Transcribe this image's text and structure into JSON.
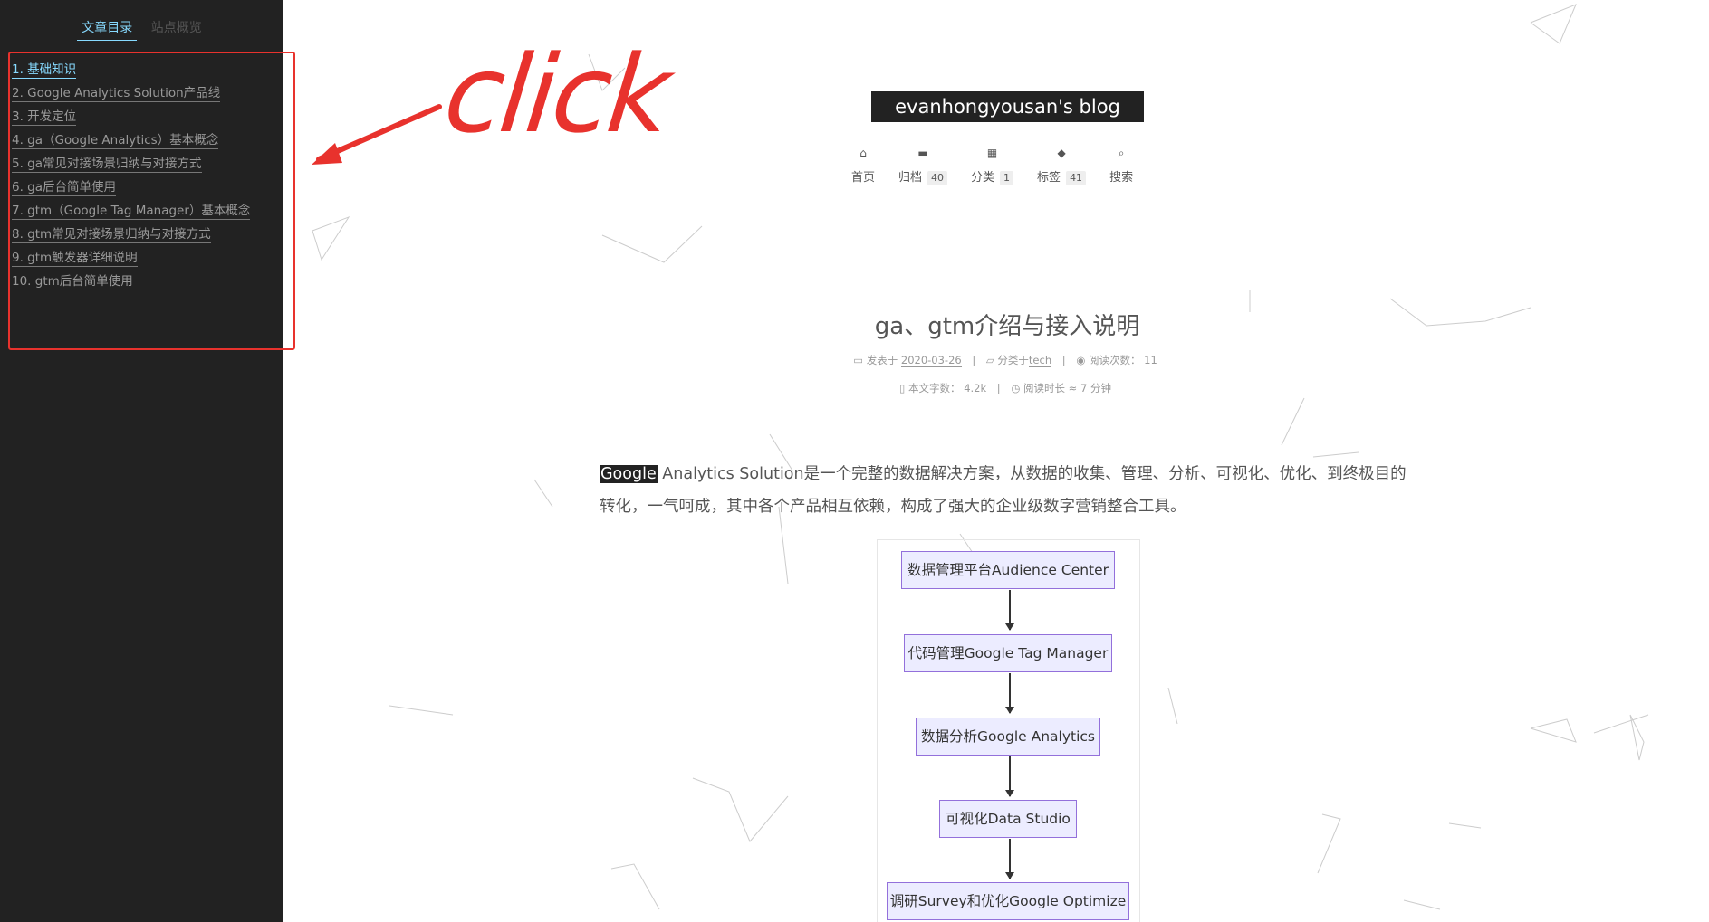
{
  "sidebar": {
    "tabs": [
      {
        "label": "文章目录",
        "active": true
      },
      {
        "label": "站点概览",
        "active": false
      }
    ],
    "toc": [
      {
        "label": "1. 基础知识",
        "active": true
      },
      {
        "label": "2. Google Analytics Solution产品线",
        "active": false
      },
      {
        "label": "3. 开发定位",
        "active": false
      },
      {
        "label": "4. ga（Google Analytics）基本概念",
        "active": false
      },
      {
        "label": "5. ga常见对接场景归纳与对接方式",
        "active": false
      },
      {
        "label": "6. ga后台简单使用",
        "active": false
      },
      {
        "label": "7. gtm（Google Tag Manager）基本概念",
        "active": false
      },
      {
        "label": "8. gtm常见对接场景归纳与对接方式",
        "active": false
      },
      {
        "label": "9. gtm触发器详细说明",
        "active": false
      },
      {
        "label": "10. gtm后台简单使用",
        "active": false
      }
    ]
  },
  "annotation": {
    "text": "click",
    "color": "#e8322d"
  },
  "header": {
    "brand": "evanhongyousan's blog",
    "menu": [
      {
        "icon": "home-icon",
        "glyph": "⌂",
        "label": "首页",
        "badge": ""
      },
      {
        "icon": "archive-icon",
        "glyph": "▬",
        "label": "归档",
        "badge": "40"
      },
      {
        "icon": "grid-icon",
        "glyph": "▦",
        "label": "分类",
        "badge": "1"
      },
      {
        "icon": "tags-icon",
        "glyph": "◆",
        "label": "标签",
        "badge": "41"
      },
      {
        "icon": "search-icon",
        "glyph": "⌕",
        "label": "搜索",
        "badge": ""
      }
    ]
  },
  "post": {
    "title": "ga、gtm介绍与接入说明",
    "meta": {
      "published_label": "发表于",
      "published_date": "2020-03-26",
      "category_label": "分类于",
      "category": "tech",
      "views_label": "阅读次数：",
      "views": "11",
      "words_label": "本文字数：",
      "words": "4.2k",
      "read_time_label": "阅读时长 ≈",
      "read_time": "7 分钟"
    },
    "intro_highlight": "Google",
    "intro_rest": " Analytics Solution是一个完整的数据解决方案，从数据的收集、管理、分析、可视化、优化、到终极目的转化，一气呵成，其中各个产品相互依赖，构成了强大的企业级数字营销整合工具。"
  },
  "diagram": {
    "nodes": [
      "数据管理平台Audience Center",
      "代码管理Google Tag Manager",
      "数据分析Google Analytics",
      "可视化Data Studio",
      "调研Survey和优化Google Optimize"
    ],
    "node_fill": "#ececff",
    "node_border": "#9370db"
  }
}
